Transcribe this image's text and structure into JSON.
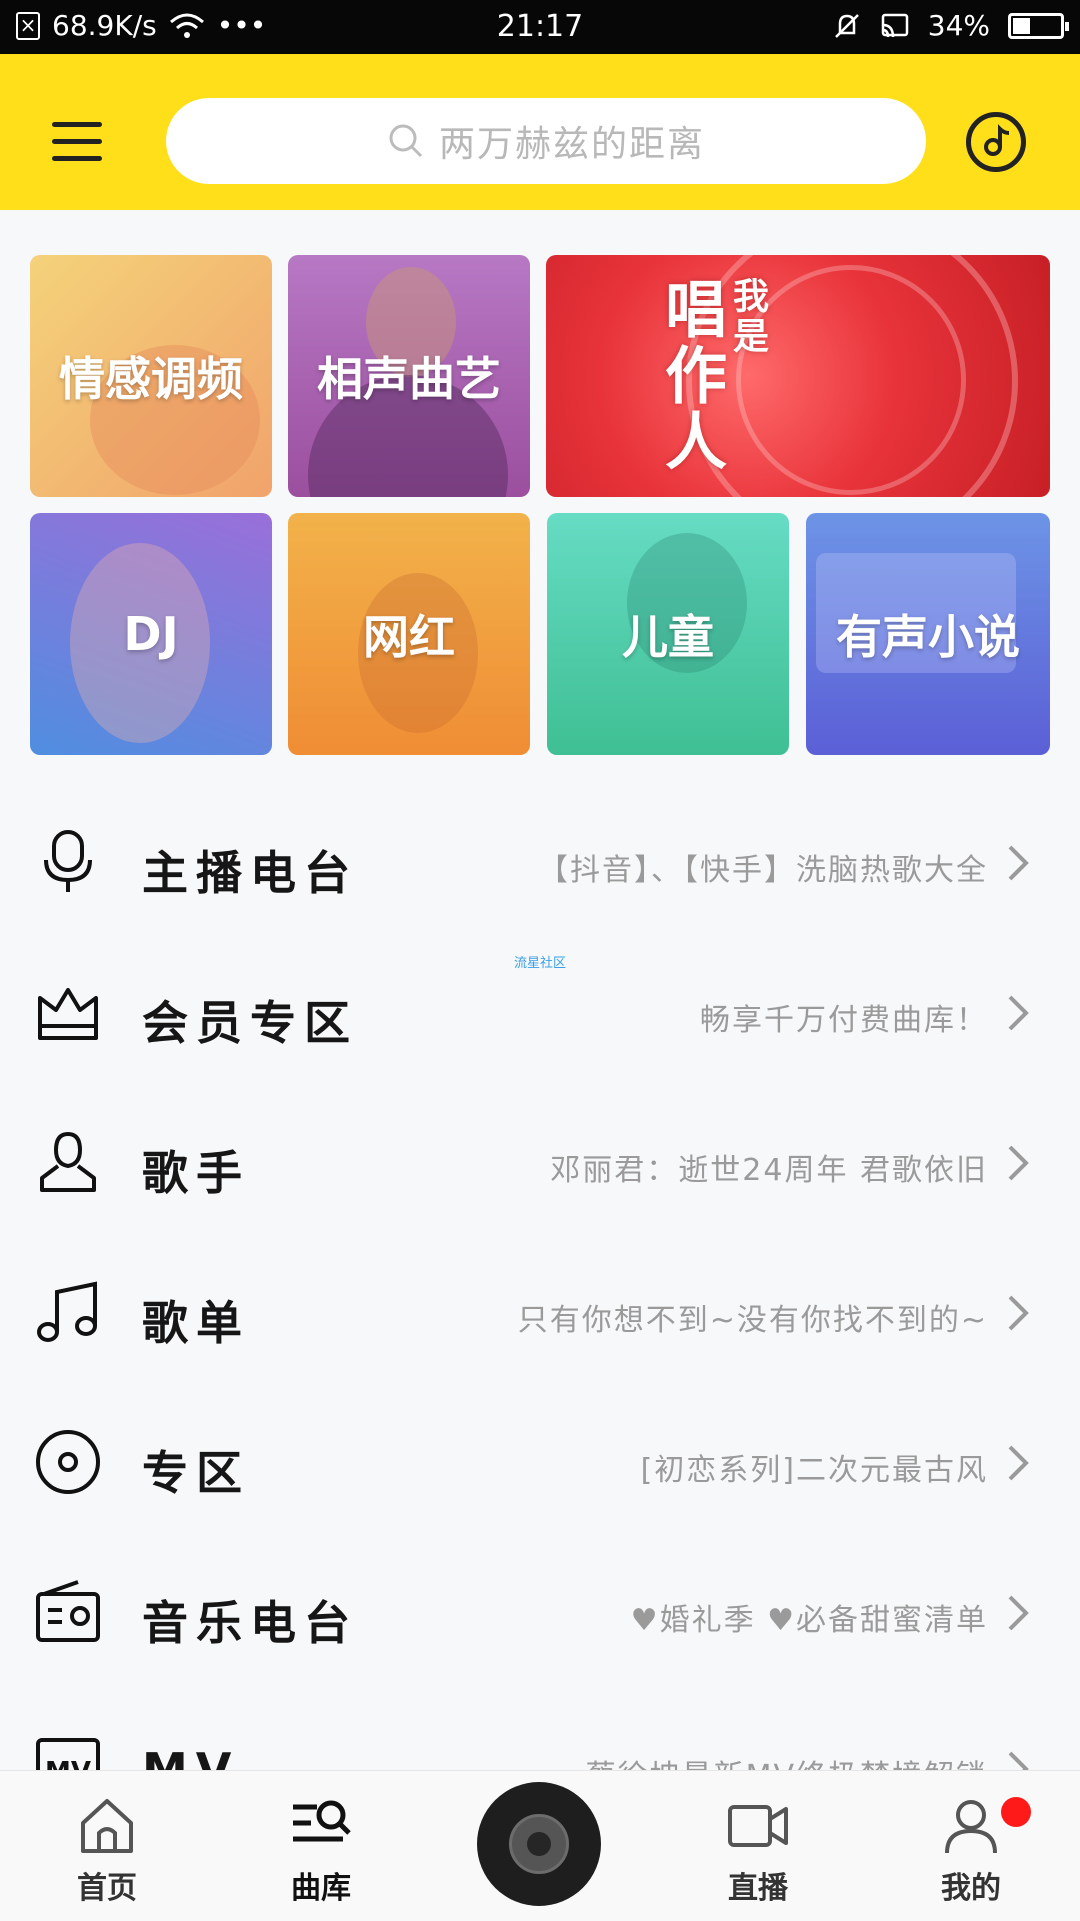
{
  "status_bar": {
    "speed": "68.9K/s",
    "more": "•••",
    "time": "21:17",
    "battery": "34%",
    "battery_level": 0.34
  },
  "header": {
    "search_placeholder": "两万赫兹的距离"
  },
  "categories": [
    {
      "label": "情感调频",
      "color": "#f2b876"
    },
    {
      "label": "相声曲艺",
      "color": "#b66bb8"
    },
    {
      "label": "我是唱作人",
      "banner_text": [
        "唱作人",
        "我是"
      ],
      "color": "#e8333a"
    },
    {
      "label": "DJ",
      "color": "#7b6fd6"
    },
    {
      "label": "网红",
      "color": "#f0a23c"
    },
    {
      "label": "儿童",
      "color": "#4fcfb2"
    },
    {
      "label": "有声小说",
      "color": "#6f78e0"
    }
  ],
  "menu": [
    {
      "icon": "microphone-icon",
      "title": "主播电台",
      "desc": "【抖音】、【快手】洗脑热歌大全"
    },
    {
      "icon": "crown-icon",
      "title": "会员专区",
      "desc": "畅享千万付费曲库！"
    },
    {
      "icon": "person-icon",
      "title": "歌手",
      "desc": "邓丽君：逝世24周年 君歌依旧"
    },
    {
      "icon": "music-note-icon",
      "title": "歌单",
      "desc": "只有你想不到~没有你找不到的~"
    },
    {
      "icon": "disc-icon",
      "title": "专区",
      "desc": "[初恋系列]二次元最古风"
    },
    {
      "icon": "radio-icon",
      "title": "音乐电台",
      "desc": "♥婚礼季 ♥必备甜蜜清单"
    },
    {
      "icon": "mv-icon",
      "title": "MV",
      "desc": "蔡徐坤最新MV终极梦境解锁"
    }
  ],
  "watermark": "流星社区",
  "tabs": [
    {
      "label": "首页",
      "icon": "home-icon"
    },
    {
      "label": "曲库",
      "icon": "library-search-icon",
      "active": true
    },
    {
      "label": "直播",
      "icon": "video-camera-icon"
    },
    {
      "label": "我的",
      "icon": "profile-icon",
      "badge": true
    }
  ],
  "colors": {
    "header": "#ffdf1a",
    "badge": "#ff1a1a",
    "text_secondary": "#9a9a9a"
  }
}
